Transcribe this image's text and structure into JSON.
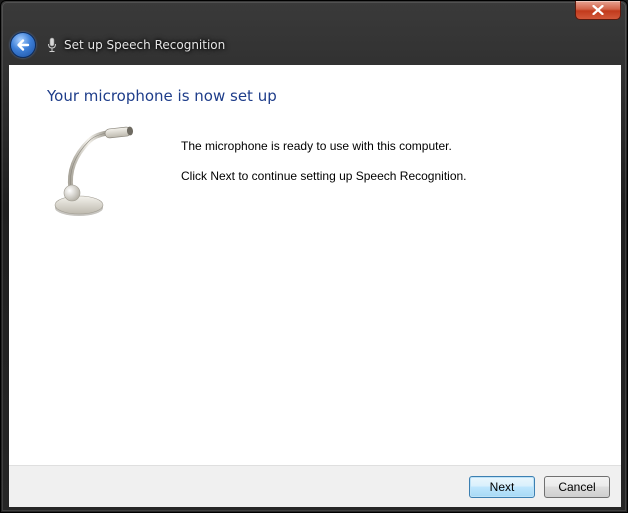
{
  "window": {
    "close_icon": "close-icon",
    "back_icon": "back-arrow-icon",
    "title_icon": "microphone-icon",
    "title": "Set up Speech Recognition"
  },
  "content": {
    "heading": "Your microphone is now set up",
    "illustration": "microphone-illustration",
    "message_ready": "The microphone is ready to use with this computer.",
    "message_next": "Click Next to continue setting up Speech Recognition."
  },
  "footer": {
    "next_label": "Next",
    "cancel_label": "Cancel"
  },
  "colors": {
    "heading": "#1e3d8a",
    "close_button": "#c23a1c",
    "back_button": "#3d7fd8"
  }
}
